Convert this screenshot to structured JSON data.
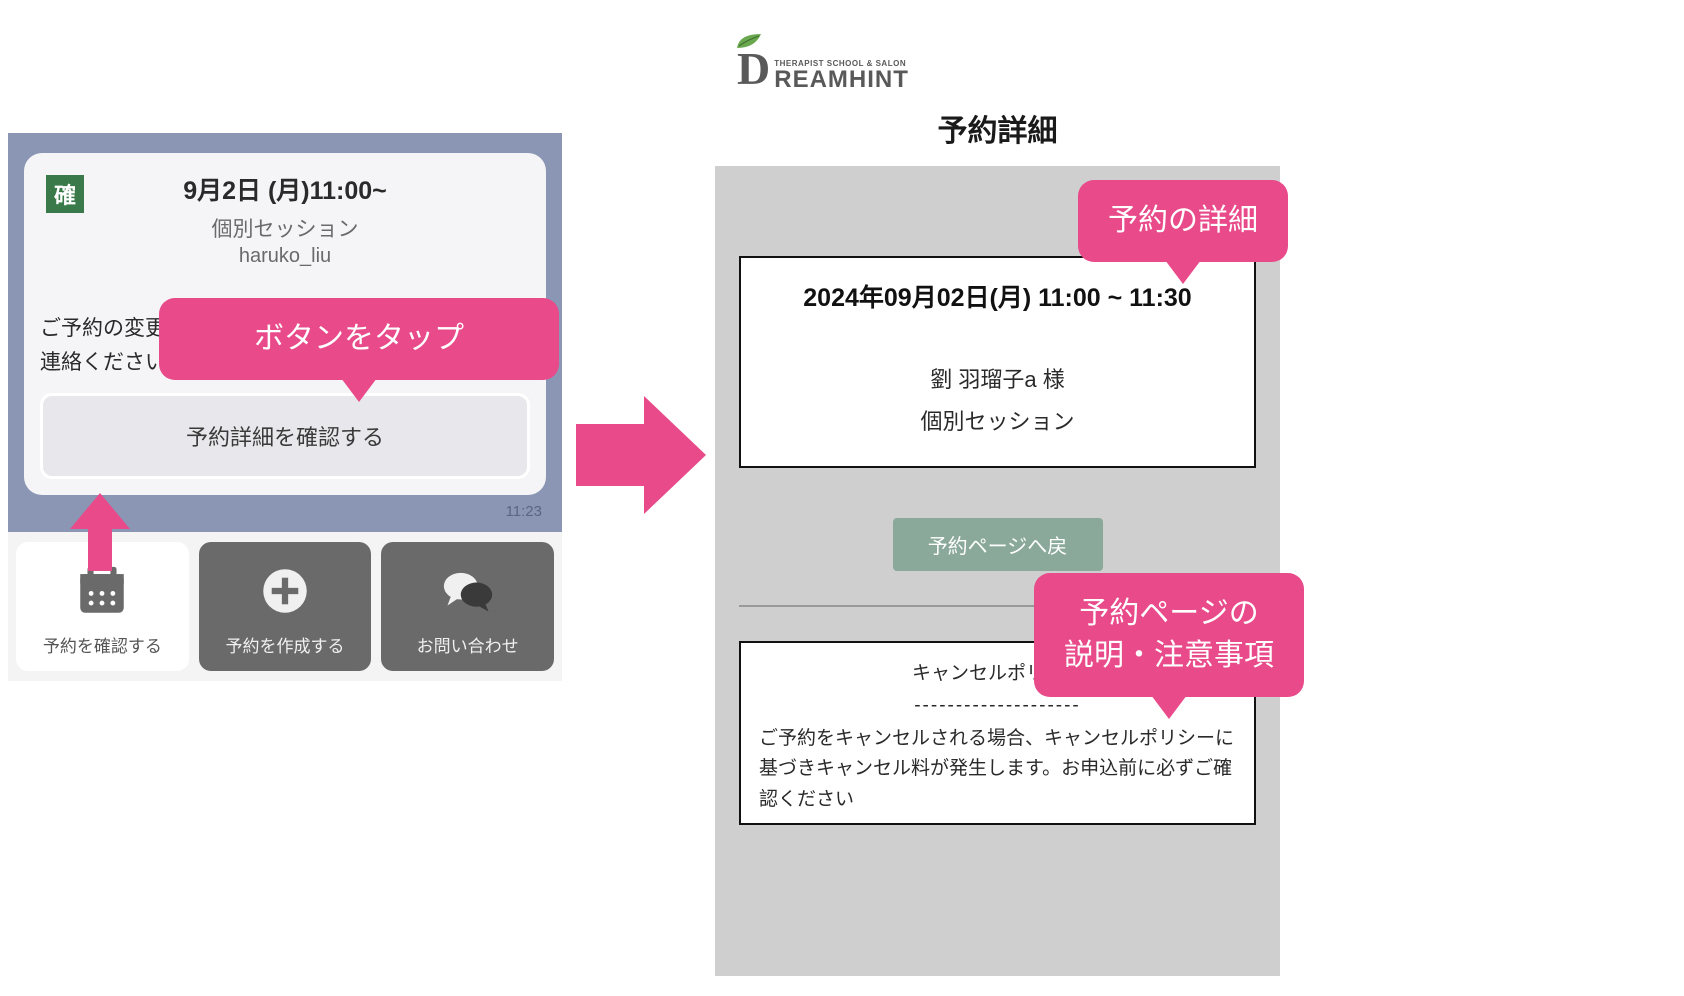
{
  "left": {
    "badge": "確",
    "title": "9月2日 (月)11:00~",
    "sub1": "個別セッション",
    "sub2": "haruko_liu",
    "note": "ご予約の変更\n連絡ください",
    "action_label": "予約詳細を確認する",
    "timestamp": "11:23",
    "tabs": [
      {
        "label": "予約を確認する"
      },
      {
        "label": "予約を作成する"
      },
      {
        "label": "お問い合わせ"
      }
    ]
  },
  "right": {
    "logo_tag": "THERAPIST SCHOOL & SALON",
    "logo_rest": "REAMHINT",
    "page_title": "予約詳細",
    "detail_date": "2024年09月02日(月) 11:00 ~ 11:30",
    "customer": "劉 羽瑠子a 様",
    "service": "個別セッション",
    "back_label": "予約ページへ戻",
    "policy_title": "キャンセルポリシー",
    "policy_divider": "--------------------",
    "policy_body": "ご予約をキャンセルされる場合、キャンセルポリシーに基づきキャンセル料が発生します。お申込前に必ずご確認ください"
  },
  "callouts": {
    "c1": "ボタンをタップ",
    "c2": "予約の詳細",
    "c3": "予約ページの\n説明・注意事項"
  }
}
